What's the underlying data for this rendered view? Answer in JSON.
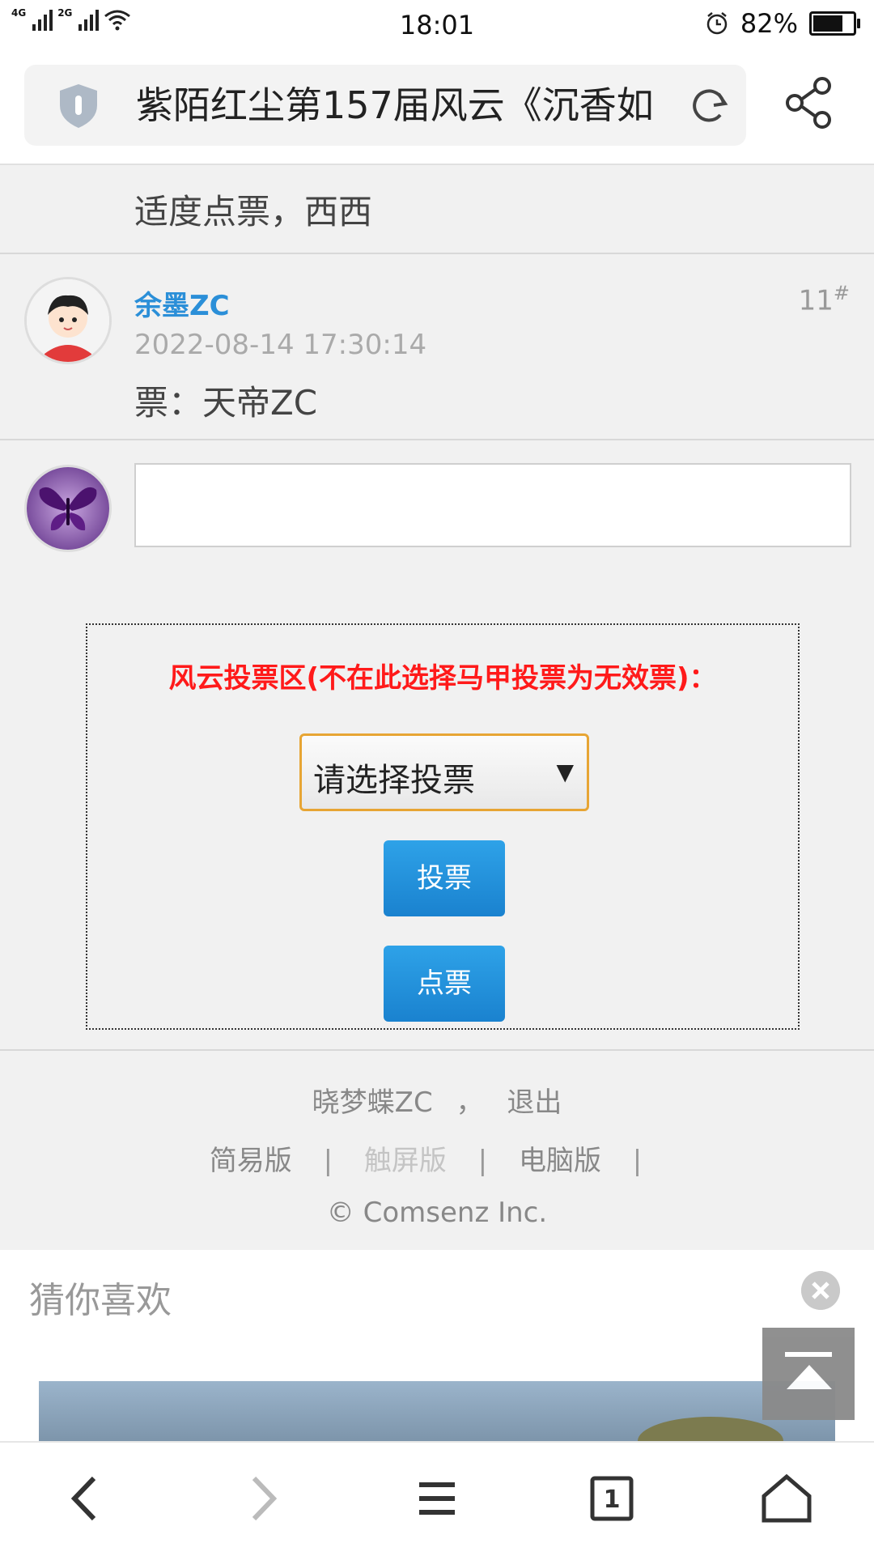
{
  "status_bar": {
    "network_1": "4G",
    "network_2": "2G",
    "time": "18:01",
    "battery_percent": "82%",
    "battery_level": 0.82
  },
  "address_bar": {
    "title": "紫陌红尘第157届风云《沉香如"
  },
  "previous_post": {
    "text": "适度点票，西西"
  },
  "post": {
    "username": "余墨ZC",
    "floor": "11",
    "floor_suffix": "#",
    "timestamp": "2022-08-14 17:30:14",
    "body": "票：天帝ZC"
  },
  "vote": {
    "title": "风云投票区(不在此选择马甲投票为无效票)：",
    "select_placeholder": "请选择投票",
    "vote_button": "投票",
    "dianpiao_button": "点票"
  },
  "footer": {
    "user": "晓梦蝶ZC",
    "comma": "，",
    "logout": "退出",
    "simple": "简易版",
    "touch": "触屏版",
    "desktop": "电脑版",
    "separator": "|",
    "copyright": "© Comsenz Inc."
  },
  "recommendations": {
    "title": "猜你喜欢"
  },
  "colors": {
    "username": "#2b8fd8",
    "vote_title": "#ff1a1a",
    "button": "#1f8fdc",
    "select_border": "#e7a534"
  }
}
